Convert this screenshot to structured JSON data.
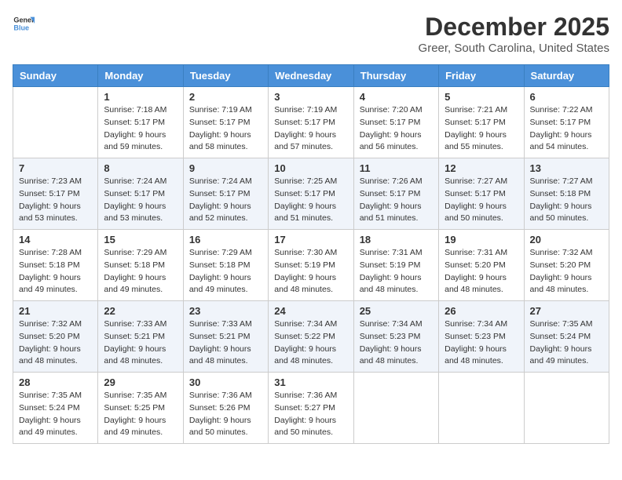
{
  "logo": {
    "line1": "General",
    "line2": "Blue"
  },
  "title": "December 2025",
  "location": "Greer, South Carolina, United States",
  "days_of_week": [
    "Sunday",
    "Monday",
    "Tuesday",
    "Wednesday",
    "Thursday",
    "Friday",
    "Saturday"
  ],
  "weeks": [
    [
      {
        "day": "",
        "info": ""
      },
      {
        "day": "1",
        "info": "Sunrise: 7:18 AM\nSunset: 5:17 PM\nDaylight: 9 hours\nand 59 minutes."
      },
      {
        "day": "2",
        "info": "Sunrise: 7:19 AM\nSunset: 5:17 PM\nDaylight: 9 hours\nand 58 minutes."
      },
      {
        "day": "3",
        "info": "Sunrise: 7:19 AM\nSunset: 5:17 PM\nDaylight: 9 hours\nand 57 minutes."
      },
      {
        "day": "4",
        "info": "Sunrise: 7:20 AM\nSunset: 5:17 PM\nDaylight: 9 hours\nand 56 minutes."
      },
      {
        "day": "5",
        "info": "Sunrise: 7:21 AM\nSunset: 5:17 PM\nDaylight: 9 hours\nand 55 minutes."
      },
      {
        "day": "6",
        "info": "Sunrise: 7:22 AM\nSunset: 5:17 PM\nDaylight: 9 hours\nand 54 minutes."
      }
    ],
    [
      {
        "day": "7",
        "info": "Sunrise: 7:23 AM\nSunset: 5:17 PM\nDaylight: 9 hours\nand 53 minutes."
      },
      {
        "day": "8",
        "info": "Sunrise: 7:24 AM\nSunset: 5:17 PM\nDaylight: 9 hours\nand 53 minutes."
      },
      {
        "day": "9",
        "info": "Sunrise: 7:24 AM\nSunset: 5:17 PM\nDaylight: 9 hours\nand 52 minutes."
      },
      {
        "day": "10",
        "info": "Sunrise: 7:25 AM\nSunset: 5:17 PM\nDaylight: 9 hours\nand 51 minutes."
      },
      {
        "day": "11",
        "info": "Sunrise: 7:26 AM\nSunset: 5:17 PM\nDaylight: 9 hours\nand 51 minutes."
      },
      {
        "day": "12",
        "info": "Sunrise: 7:27 AM\nSunset: 5:17 PM\nDaylight: 9 hours\nand 50 minutes."
      },
      {
        "day": "13",
        "info": "Sunrise: 7:27 AM\nSunset: 5:18 PM\nDaylight: 9 hours\nand 50 minutes."
      }
    ],
    [
      {
        "day": "14",
        "info": "Sunrise: 7:28 AM\nSunset: 5:18 PM\nDaylight: 9 hours\nand 49 minutes."
      },
      {
        "day": "15",
        "info": "Sunrise: 7:29 AM\nSunset: 5:18 PM\nDaylight: 9 hours\nand 49 minutes."
      },
      {
        "day": "16",
        "info": "Sunrise: 7:29 AM\nSunset: 5:18 PM\nDaylight: 9 hours\nand 49 minutes."
      },
      {
        "day": "17",
        "info": "Sunrise: 7:30 AM\nSunset: 5:19 PM\nDaylight: 9 hours\nand 48 minutes."
      },
      {
        "day": "18",
        "info": "Sunrise: 7:31 AM\nSunset: 5:19 PM\nDaylight: 9 hours\nand 48 minutes."
      },
      {
        "day": "19",
        "info": "Sunrise: 7:31 AM\nSunset: 5:20 PM\nDaylight: 9 hours\nand 48 minutes."
      },
      {
        "day": "20",
        "info": "Sunrise: 7:32 AM\nSunset: 5:20 PM\nDaylight: 9 hours\nand 48 minutes."
      }
    ],
    [
      {
        "day": "21",
        "info": "Sunrise: 7:32 AM\nSunset: 5:20 PM\nDaylight: 9 hours\nand 48 minutes."
      },
      {
        "day": "22",
        "info": "Sunrise: 7:33 AM\nSunset: 5:21 PM\nDaylight: 9 hours\nand 48 minutes."
      },
      {
        "day": "23",
        "info": "Sunrise: 7:33 AM\nSunset: 5:21 PM\nDaylight: 9 hours\nand 48 minutes."
      },
      {
        "day": "24",
        "info": "Sunrise: 7:34 AM\nSunset: 5:22 PM\nDaylight: 9 hours\nand 48 minutes."
      },
      {
        "day": "25",
        "info": "Sunrise: 7:34 AM\nSunset: 5:23 PM\nDaylight: 9 hours\nand 48 minutes."
      },
      {
        "day": "26",
        "info": "Sunrise: 7:34 AM\nSunset: 5:23 PM\nDaylight: 9 hours\nand 48 minutes."
      },
      {
        "day": "27",
        "info": "Sunrise: 7:35 AM\nSunset: 5:24 PM\nDaylight: 9 hours\nand 49 minutes."
      }
    ],
    [
      {
        "day": "28",
        "info": "Sunrise: 7:35 AM\nSunset: 5:24 PM\nDaylight: 9 hours\nand 49 minutes."
      },
      {
        "day": "29",
        "info": "Sunrise: 7:35 AM\nSunset: 5:25 PM\nDaylight: 9 hours\nand 49 minutes."
      },
      {
        "day": "30",
        "info": "Sunrise: 7:36 AM\nSunset: 5:26 PM\nDaylight: 9 hours\nand 50 minutes."
      },
      {
        "day": "31",
        "info": "Sunrise: 7:36 AM\nSunset: 5:27 PM\nDaylight: 9 hours\nand 50 minutes."
      },
      {
        "day": "",
        "info": ""
      },
      {
        "day": "",
        "info": ""
      },
      {
        "day": "",
        "info": ""
      }
    ]
  ]
}
